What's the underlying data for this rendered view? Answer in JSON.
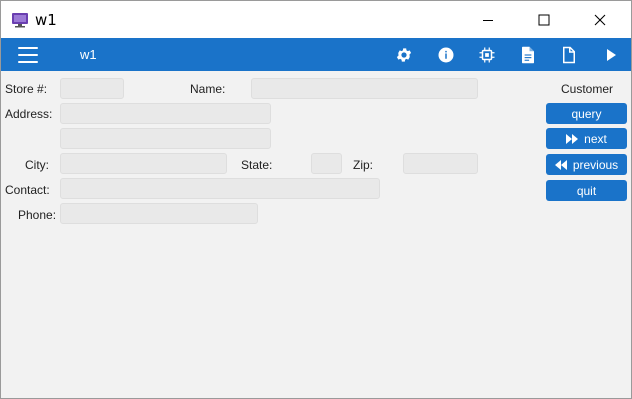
{
  "window": {
    "title": "w1"
  },
  "toolbar": {
    "title": "w1",
    "icons": [
      "menu-icon",
      "gear-icon",
      "info-icon",
      "chip-icon",
      "document-icon",
      "blank-document-icon",
      "play-icon"
    ]
  },
  "form": {
    "store_label": "Store #:",
    "name_label": "Name:",
    "address_label": "Address:",
    "city_label": "City:",
    "state_label": "State:",
    "zip_label": "Zip:",
    "contact_label": "Contact:",
    "phone_label": "Phone:",
    "store_value": "",
    "name_value": "",
    "address1_value": "",
    "address2_value": "",
    "city_value": "",
    "state_value": "",
    "zip_value": "",
    "contact_value": "",
    "phone_value": ""
  },
  "side": {
    "heading": "Customer",
    "query_label": "query",
    "next_label": "next",
    "previous_label": "previous",
    "quit_label": "quit"
  },
  "colors": {
    "accent": "#1a73c9",
    "field_bg": "#e9e9e9",
    "content_bg": "#f2f2f2"
  }
}
